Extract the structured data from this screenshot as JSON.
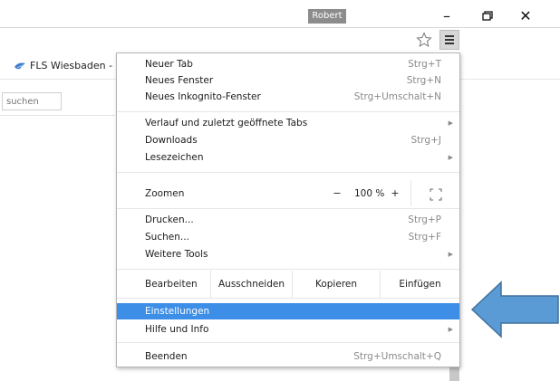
{
  "window": {
    "profile_name": "Robert",
    "minimize_glyph": "–",
    "maximize_glyph": "🗗",
    "close_glyph": "✕"
  },
  "bookmarks": {
    "item_label": "FLS Wiesbaden - W...",
    "icon": "bird-favicon-icon"
  },
  "page": {
    "search_placeholder": "suchen"
  },
  "menu": {
    "new_tab": {
      "label": "Neuer Tab",
      "shortcut": "Strg+T"
    },
    "new_window": {
      "label": "Neues Fenster",
      "shortcut": "Strg+N"
    },
    "incognito": {
      "label": "Neues Inkognito-Fenster",
      "shortcut": "Strg+Umschalt+N"
    },
    "history": {
      "label": "Verlauf und zuletzt geöffnete Tabs"
    },
    "downloads": {
      "label": "Downloads",
      "shortcut": "Strg+J"
    },
    "bookmarks": {
      "label": "Lesezeichen"
    },
    "zoom": {
      "label": "Zoomen",
      "minus": "−",
      "level": "100 %",
      "plus": "+"
    },
    "print": {
      "label": "Drucken...",
      "shortcut": "Strg+P"
    },
    "find": {
      "label": "Suchen...",
      "shortcut": "Strg+F"
    },
    "more_tools": {
      "label": "Weitere Tools"
    },
    "edit": {
      "label": "Bearbeiten",
      "cut": "Ausschneiden",
      "copy": "Kopieren",
      "paste": "Einfügen"
    },
    "settings": {
      "label": "Einstellungen"
    },
    "help": {
      "label": "Hilfe und Info"
    },
    "exit": {
      "label": "Beenden",
      "shortcut": "Strg+Umschalt+Q"
    }
  },
  "colors": {
    "highlight": "#3c8ee6",
    "arrow_fill": "#5b9bd5",
    "arrow_stroke": "#41719c"
  }
}
